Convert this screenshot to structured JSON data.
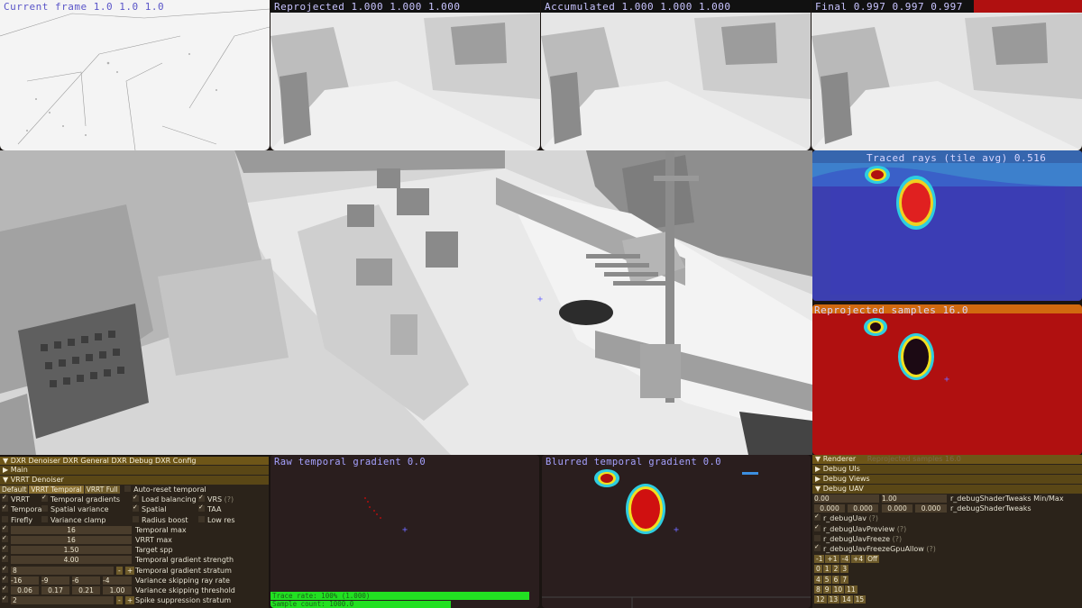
{
  "thumbnails": [
    {
      "caption": "Current frame 1.0 1.0 1.0",
      "light": false
    },
    {
      "caption": "Reprojected 1.000 1.000 1.000",
      "light": true
    },
    {
      "caption": "Accumulated 1.000 1.000 1.000",
      "light": true
    },
    {
      "caption": "Final 0.997 0.997 0.997",
      "light": true
    }
  ],
  "heatmaps": {
    "top_caption": "Traced rays (tile avg) 0.516",
    "bottom_caption": "Reprojected samples 16.0"
  },
  "denoiser_panel": {
    "tabs_title": "DXR Denoiser  DXR General  DXR Debug  DXR Config",
    "main_label": "Main",
    "section_label": "VRRT Denoiser",
    "presets": [
      "Default",
      "VRRT Temporal",
      "VRRT Full"
    ],
    "preset_selected": 1,
    "auto_reset_label": "Auto-reset temporal",
    "checks": [
      {
        "label": "VRRT",
        "on": true
      },
      {
        "label": "Temporal gradients",
        "on": true
      },
      {
        "label": "Load balancing",
        "on": true
      },
      {
        "label": "VRS",
        "on": true,
        "hint": "(?)"
      },
      {
        "label": "Temporal",
        "on": true
      },
      {
        "label": "Spatial variance",
        "on": false
      },
      {
        "label": "Spatial",
        "on": true
      },
      {
        "label": "TAA",
        "on": true
      },
      {
        "label": "Firefly",
        "on": false
      },
      {
        "label": "Variance clamp",
        "on": false
      },
      {
        "label": "Radius boost",
        "on": false
      },
      {
        "label": "Low res",
        "on": false
      }
    ],
    "sliders": [
      {
        "value": "16",
        "label": "Temporal max"
      },
      {
        "value": "16",
        "label": "VRRT max"
      },
      {
        "value": "1.50",
        "label": "Target spp"
      },
      {
        "value": "4.00",
        "label": "Temporal gradient strength"
      }
    ],
    "stepper": {
      "value": "8",
      "minus": "-",
      "plus": "+",
      "label": "Temporal gradient stratum"
    },
    "ray_rate": {
      "values": [
        "-16",
        "-9",
        "-6",
        "-4"
      ],
      "label": "Variance skipping ray rate"
    },
    "threshold": {
      "values": [
        "0.06",
        "0.17",
        "0.21",
        "1.00"
      ],
      "label": "Variance skipping threshold"
    },
    "spike": {
      "value": "2",
      "minus": "-",
      "plus": "+",
      "label": "Spike suppression stratum"
    }
  },
  "gradient_panels": {
    "raw_title": "Raw temporal gradient 0.0",
    "blurred_title": "Blurred temporal gradient 0.0",
    "bar_text_1": "Trace rate: 100% (1.000)",
    "bar_text_2": "Sample count: 1000.0",
    "progress": 0.96
  },
  "renderer_panel": {
    "title": "Renderer",
    "under_caption": "Reprojected samples 16.0",
    "sections": [
      "Debug UIs",
      "Debug Views",
      "Debug UAV"
    ],
    "minmax": {
      "a": "0.00",
      "b": "1.00",
      "label": "r_debugShaderTweaks Min/Max"
    },
    "tweaks": {
      "values": [
        "0.000",
        "0.000",
        "0.000",
        "0.000"
      ],
      "label": "r_debugShaderTweaks"
    },
    "flags": [
      {
        "label": "r_debugUav",
        "on": true,
        "hint": "(?)"
      },
      {
        "label": "r_debugUavPreview",
        "on": true,
        "hint": "(?)"
      },
      {
        "label": "r_debugUavFreeze",
        "on": false,
        "hint": "(?)"
      },
      {
        "label": "r_debugUavFreezeGpuAllow",
        "on": true,
        "hint": "(?)"
      }
    ],
    "step_buttons": [
      "-1",
      "+1",
      "-4",
      "+4",
      "Off"
    ],
    "grid": [
      [
        "0",
        "1",
        "2",
        "3"
      ],
      [
        "4",
        "5",
        "6",
        "7"
      ],
      [
        "8",
        "9",
        "10",
        "11"
      ],
      [
        "12",
        "13",
        "14",
        "15"
      ]
    ]
  },
  "colors": {
    "panel_bg": "#2a1e1e",
    "header": "#6e5618",
    "heatmap_red": "#b01010",
    "heatmap_blue": "#3c3fb0",
    "bar_green": "#22e022"
  }
}
